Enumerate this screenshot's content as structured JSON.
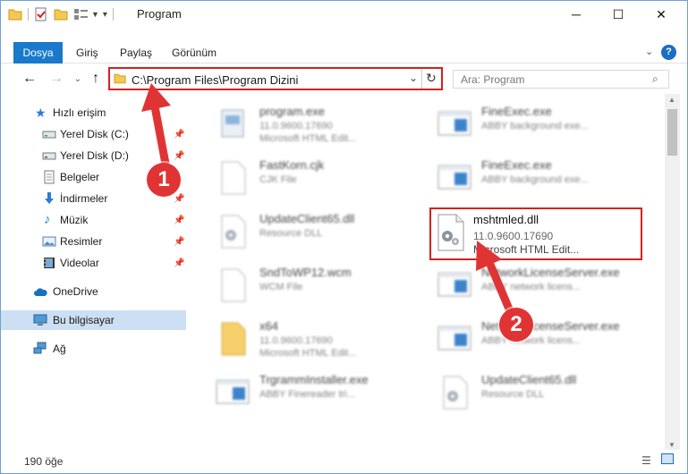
{
  "window": {
    "title": "Program",
    "minimize_glyph": "─",
    "maximize_glyph": "☐",
    "close_glyph": "✕"
  },
  "ribbon": {
    "tabs": [
      "Dosya",
      "Giriş",
      "Paylaş",
      "Görünüm"
    ],
    "help_label": "?"
  },
  "address": {
    "path": "C:\\Program Files\\Program Dizini",
    "search_placeholder": "Ara: Program"
  },
  "sidebar": {
    "quick_access": "Hızlı erişim",
    "items": [
      {
        "label": "Yerel Disk (C:)",
        "icon": "drive-icon"
      },
      {
        "label": "Yerel Disk (D:)",
        "icon": "drive-icon"
      },
      {
        "label": "Belgeler",
        "icon": "documents-icon"
      },
      {
        "label": "İndirmeler",
        "icon": "downloads-icon"
      },
      {
        "label": "Müzik",
        "icon": "music-icon"
      },
      {
        "label": "Resimler",
        "icon": "pictures-icon"
      },
      {
        "label": "Videolar",
        "icon": "videos-icon"
      }
    ],
    "onedrive": "OneDrive",
    "this_pc": "Bu bilgisayar",
    "network": "Ağ"
  },
  "files": {
    "left": [
      {
        "name": "program.exe",
        "l1": "11.0.9600.17690",
        "l2": "Microsoft HTML Edit..."
      },
      {
        "name": "FastKorn.cjk",
        "l1": "CJK File",
        "l2": ""
      },
      {
        "name": "UpdateClient65.dll",
        "l1": "Resource DLL",
        "l2": ""
      },
      {
        "name": "SndToWP12.wcm",
        "l1": "WCM File",
        "l2": ""
      },
      {
        "name": "x64",
        "l1": "11.0.9600.17690",
        "l2": "Microsoft HTML Edit..."
      },
      {
        "name": "TrgrammInstaller.exe",
        "l1": "ABBY Finereader tri...",
        "l2": ""
      }
    ],
    "right": [
      {
        "name": "FineExec.exe",
        "l1": "ABBY background exe...",
        "l2": ""
      },
      {
        "name": "FineExec.exe",
        "l1": "ABBY background exe...",
        "l2": ""
      },
      {
        "name": "NetworkLicenseServer.exe",
        "l1": "ABBY network licens...",
        "l2": ""
      },
      {
        "name": "NetworkLicenseServer.exe",
        "l1": "ABBY network licens...",
        "l2": ""
      },
      {
        "name": "UpdateClient65.dll",
        "l1": "Resource DLL",
        "l2": ""
      }
    ],
    "highlighted": {
      "name": "mshtmled.dll",
      "l1": "11.0.9600.17690",
      "l2": "Microsoft HTML Edit..."
    }
  },
  "status": {
    "item_count": "190 öğe"
  },
  "annotations": {
    "step1": "1",
    "step2": "2",
    "color": "#e03434"
  }
}
